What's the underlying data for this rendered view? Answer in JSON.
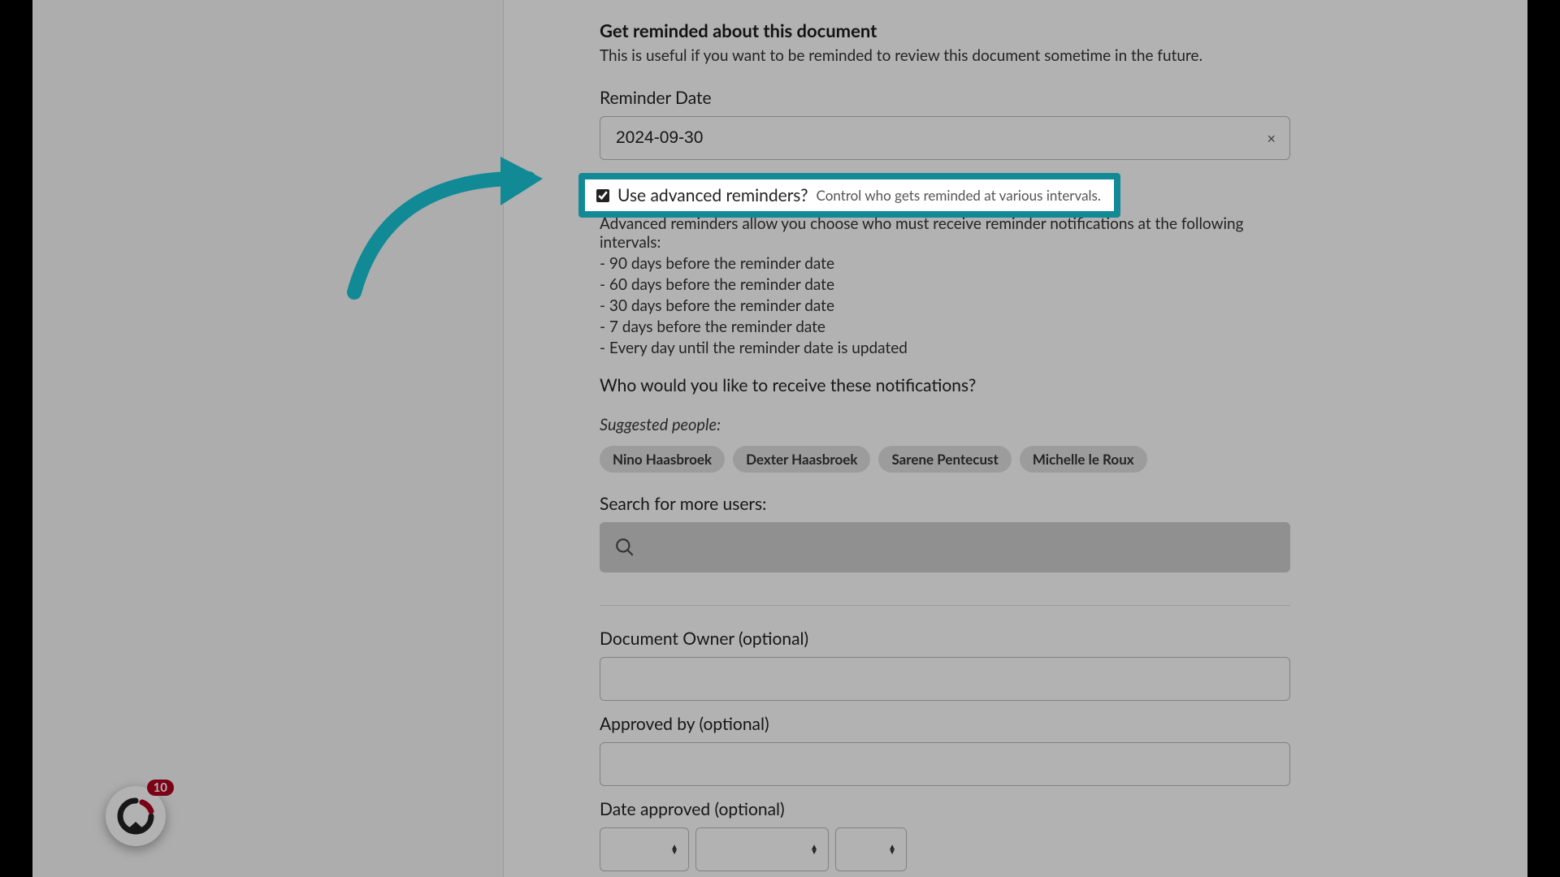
{
  "reminder": {
    "title": "Get reminded about this document",
    "description": "This is useful if you want to be reminded to review this document sometime in the future.",
    "date_label": "Reminder Date",
    "date_value": "2024-09-30",
    "advanced": {
      "checkbox_checked": true,
      "label": "Use advanced reminders?",
      "hint": "Control who gets reminded at various intervals.",
      "description": "Advanced reminders allow you choose who must receive reminder notifications at the following intervals:",
      "intervals": [
        "- 90 days before the reminder date",
        "- 60 days before the reminder date",
        "- 30 days before the reminder date",
        "- 7 days before the reminder date",
        "- Every day until the reminder date is updated"
      ],
      "who_label": "Who would you like to receive these notifications?"
    },
    "suggested_label": "Suggested people:",
    "suggested_people": [
      "Nino Haasbroek",
      "Dexter Haasbroek",
      "Sarene Pentecust",
      "Michelle le Roux"
    ],
    "search_label": "Search for more users:"
  },
  "fields": {
    "owner_label": "Document Owner (optional)",
    "approved_by_label": "Approved by (optional)",
    "date_approved_label": "Date approved (optional)"
  },
  "chat": {
    "badge_count": "10"
  },
  "colors": {
    "highlight": "#118a96"
  }
}
